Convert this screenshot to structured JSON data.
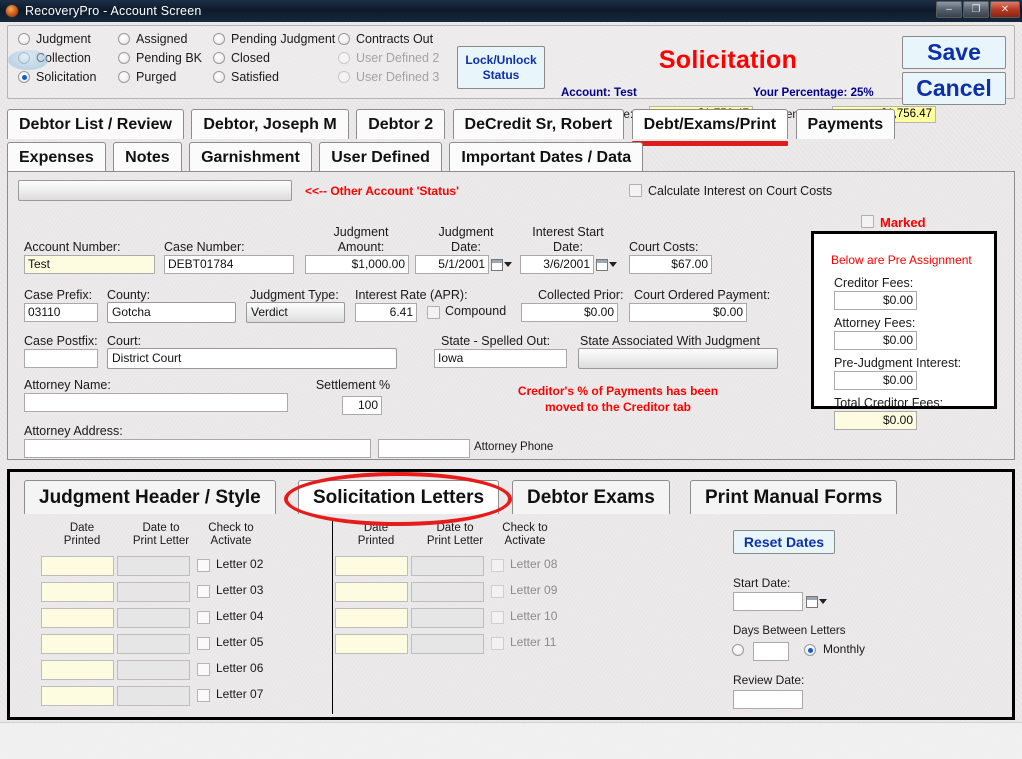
{
  "window": {
    "title": "RecoveryPro - Account Screen",
    "icon": "app-logo-icon",
    "controls": {
      "minimize": "–",
      "maximize": "❐",
      "close": "✕"
    }
  },
  "status_panel": {
    "columns": [
      {
        "items": [
          {
            "label": "Judgment",
            "checked": false,
            "disabled": false
          },
          {
            "label": "Collection",
            "checked": false,
            "disabled": false
          },
          {
            "label": "Solicitation",
            "checked": true,
            "disabled": false
          }
        ]
      },
      {
        "items": [
          {
            "label": "Assigned",
            "checked": false,
            "disabled": false
          },
          {
            "label": "Pending BK",
            "checked": false,
            "disabled": false
          },
          {
            "label": "Purged",
            "checked": false,
            "disabled": false
          }
        ]
      },
      {
        "items": [
          {
            "label": "Pending Judgment",
            "checked": false,
            "disabled": false
          },
          {
            "label": "Closed",
            "checked": false,
            "disabled": false
          },
          {
            "label": "Satisfied",
            "checked": false,
            "disabled": false
          }
        ]
      },
      {
        "items": [
          {
            "label": "Contracts Out",
            "checked": false,
            "disabled": false
          },
          {
            "label": "User Defined 2",
            "checked": false,
            "disabled": true
          },
          {
            "label": "User Defined 3",
            "checked": false,
            "disabled": true
          }
        ]
      }
    ],
    "lock_button": "Lock/Unlock Status",
    "heading": "Solicitation",
    "heading_color": "#ff0000",
    "account_label": "Account:  Test",
    "percentage_label": "Your Percentage:  25%",
    "balance_due_label": "Balance Due:",
    "balance_due_value": "$1,756.47",
    "settlement_label": "Settlement:",
    "settlement_value": "$1,756.47",
    "save_button": "Save",
    "cancel_button": "Cancel",
    "accent_blue": "#0d2fa8",
    "field_yellow": "#ffffa0"
  },
  "tabs_row1": [
    {
      "label": "Debtor List / Review",
      "active": false
    },
    {
      "label": "Debtor, Joseph M",
      "active": false
    },
    {
      "label": "Debtor 2",
      "active": false
    },
    {
      "label": "DeCredit Sr, Robert",
      "active": false
    },
    {
      "label": "Debt/Exams/Print",
      "active": true
    },
    {
      "label": "Payments",
      "active": false
    }
  ],
  "tabs_row2": [
    {
      "label": "Expenses",
      "active": false
    },
    {
      "label": "Notes",
      "active": false
    },
    {
      "label": "Garnishment",
      "active": false
    },
    {
      "label": "User Defined",
      "active": false
    },
    {
      "label": "Important Dates / Data",
      "active": false
    }
  ],
  "detail": {
    "other_status_combo_value": "",
    "other_status_note": "<<-- Other Account 'Status'",
    "calc_interest_label": "Calculate Interest on Court Costs",
    "calc_interest_checked": false,
    "marked_label": "Marked",
    "marked_checked": false,
    "account_number_label": "Account Number:",
    "account_number_value": "Test",
    "case_number_label": "Case Number:",
    "case_number_value": "DEBT01784",
    "judgment_amount_label": "Judgment\nAmount:",
    "judgment_amount_label_l1": "Judgment",
    "judgment_amount_label_l2": "Amount:",
    "judgment_amount_value": "$1,000.00",
    "judgment_date_label_l1": "Judgment",
    "judgment_date_label_l2": "Date:",
    "judgment_date_value": "5/1/2001",
    "interest_start_label_l1": "Interest Start",
    "interest_start_label_l2": "Date:",
    "interest_start_value": "3/6/2001",
    "court_costs_label": "Court Costs:",
    "court_costs_value": "$67.00",
    "case_prefix_label": "Case Prefix:",
    "case_prefix_value": "03110",
    "county_label": "County:",
    "county_value": "Gotcha",
    "judgment_type_label": "Judgment Type:",
    "judgment_type_value": "Verdict",
    "interest_rate_label": "Interest Rate (APR):",
    "interest_rate_value": "6.41",
    "compound_label": "Compound",
    "compound_checked": false,
    "collected_prior_label": "Collected  Prior:",
    "collected_prior_value": "$0.00",
    "court_ordered_payment_label": "Court Ordered Payment:",
    "court_ordered_payment_value": "$0.00",
    "case_postfix_label": "Case Postfix:",
    "case_postfix_value": "",
    "court_label": "Court:",
    "court_value": "District Court",
    "state_spelled_label": "State - Spelled Out:",
    "state_spelled_value": "Iowa",
    "state_assoc_label": "State Associated With Judgment",
    "state_assoc_value": "",
    "attorney_name_label": "Attorney Name:",
    "attorney_name_value": "",
    "settlement_pct_label": "Settlement %",
    "settlement_pct_value": "100",
    "attorney_address_label": "Attorney Address:",
    "attorney_address_value": "",
    "attorney_phone_label": "Attorney Phone",
    "attorney_phone_value": "",
    "creditor_note_l1": "Creditor's % of Payments has been",
    "creditor_note_l2": "moved to the Creditor tab",
    "preassign": {
      "header": "Below are Pre Assignment",
      "rows": [
        {
          "label": "Creditor Fees:",
          "value": "$0.00",
          "highlight": false
        },
        {
          "label": "Attorney Fees:",
          "value": "$0.00",
          "highlight": false
        },
        {
          "label": "Pre-Judgment Interest:",
          "value": "$0.00",
          "highlight": false
        },
        {
          "label": "Total Creditor Fees:",
          "value": "$0.00",
          "highlight": true
        }
      ]
    }
  },
  "bottom": {
    "tabs": [
      {
        "label": "Judgment Header / Style",
        "active": false
      },
      {
        "label": "Solicitation Letters",
        "active": true
      },
      {
        "label": "Debtor Exams",
        "active": false
      },
      {
        "label": "Print Manual Forms",
        "active": false
      }
    ],
    "annotation": "red-ellipse-highlight-on-solicitation-letters-tab",
    "columns": [
      {
        "headers": {
          "date_printed": "Date\nPrinted",
          "dp1": "Date",
          "dp2": "Printed",
          "dl1": "Date to",
          "dl2": "Print Letter",
          "ca1": "Check to",
          "ca2": "Activate"
        },
        "rows": [
          {
            "date_printed": "",
            "date_to_print": "",
            "checked": false,
            "label": "Letter 02",
            "dim": false
          },
          {
            "date_printed": "",
            "date_to_print": "",
            "checked": false,
            "label": "Letter 03",
            "dim": false
          },
          {
            "date_printed": "",
            "date_to_print": "",
            "checked": false,
            "label": "Letter 04",
            "dim": false
          },
          {
            "date_printed": "",
            "date_to_print": "",
            "checked": false,
            "label": "Letter 05",
            "dim": false
          },
          {
            "date_printed": "",
            "date_to_print": "",
            "checked": false,
            "label": "Letter 06",
            "dim": false
          },
          {
            "date_printed": "",
            "date_to_print": "",
            "checked": false,
            "label": "Letter 07",
            "dim": false
          }
        ]
      },
      {
        "headers": {
          "dp1": "Date",
          "dp2": "Printed",
          "dl1": "Date to",
          "dl2": "Print Letter",
          "ca1": "Check to",
          "ca2": "Activate"
        },
        "rows": [
          {
            "date_printed": "",
            "date_to_print": "",
            "checked": false,
            "label": "Letter 08",
            "dim": true
          },
          {
            "date_printed": "",
            "date_to_print": "",
            "checked": false,
            "label": "Letter 09",
            "dim": true
          },
          {
            "date_printed": "",
            "date_to_print": "",
            "checked": false,
            "label": "Letter 10",
            "dim": true
          },
          {
            "date_printed": "",
            "date_to_print": "",
            "checked": false,
            "label": "Letter 11",
            "dim": true
          }
        ]
      }
    ],
    "reset_dates_button": "Reset Dates",
    "start_date_label": "Start Date:",
    "start_date_value": "",
    "days_between_label": "Days Between Letters",
    "days_between_value": "",
    "days_between_radio_checked": false,
    "monthly_label": "Monthly",
    "monthly_radio_checked": true,
    "review_date_label": "Review Date:",
    "review_date_value": ""
  }
}
